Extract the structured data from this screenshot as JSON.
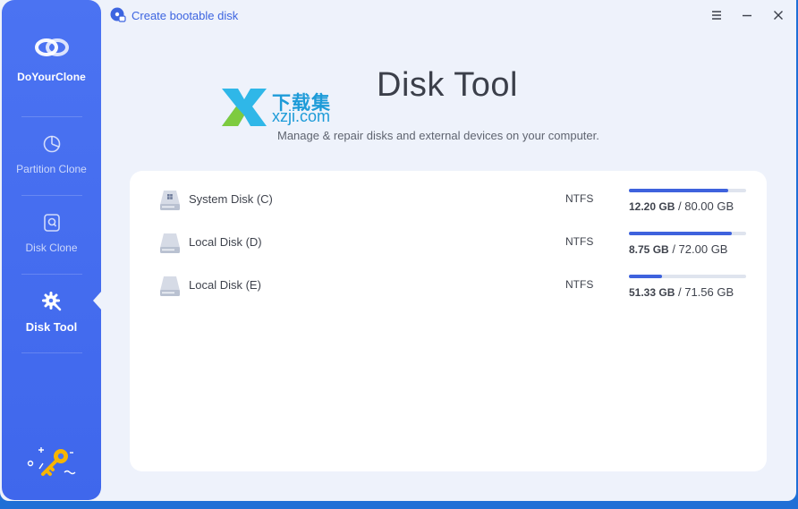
{
  "app": {
    "name": "DoYourClone"
  },
  "titlebar": {
    "boot_label": "Create bootable disk",
    "icons": [
      "menu-icon",
      "minimize-icon",
      "close-icon"
    ]
  },
  "sidebar": {
    "items": [
      {
        "label": "Partition Clone",
        "icon": "pie-chart-icon",
        "active": false
      },
      {
        "label": "Disk Clone",
        "icon": "disk-clone-icon",
        "active": false
      },
      {
        "label": "Disk Tool",
        "icon": "gear-tool-icon",
        "active": true
      }
    ],
    "bottom_icon": "license-key-icon"
  },
  "header": {
    "title": "Disk Tool",
    "subtitle": "Manage & repair disks and external devices on your computer."
  },
  "watermark": {
    "cn": "下载集",
    "en": "xzji.com"
  },
  "disks": [
    {
      "name": "System Disk (C)",
      "fs": "NTFS",
      "used": "12.20 GB",
      "total": "/ 80.00 GB",
      "fill": 0.85,
      "icon": "windows-disk-icon"
    },
    {
      "name": "Local Disk (D)",
      "fs": "NTFS",
      "used": "8.75 GB",
      "total": "/ 72.00 GB",
      "fill": 0.88,
      "icon": "hard-disk-icon"
    },
    {
      "name": "Local Disk (E)",
      "fs": "NTFS",
      "used": "51.33 GB",
      "total": "/ 71.56 GB",
      "fill": 0.28,
      "icon": "hard-disk-icon"
    }
  ],
  "colors": {
    "accent": "#3e62dd",
    "sidebar": "#4b73f2",
    "background": "#eef2fb"
  }
}
